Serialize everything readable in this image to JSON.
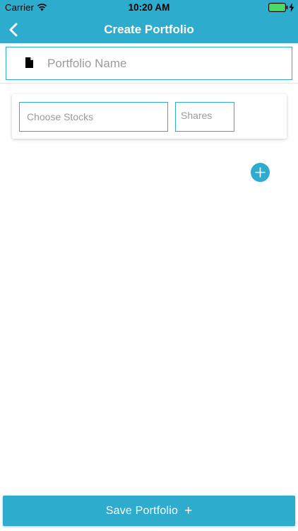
{
  "theme": {
    "accent": "#2eaccd",
    "text_on_accent": "#ffffff",
    "placeholder": "#9b9b9b"
  },
  "status_bar": {
    "carrier": "Carrier",
    "time": "10:20 AM",
    "icons": [
      "wifi-icon",
      "battery-icon",
      "charging-bolt-icon"
    ]
  },
  "nav": {
    "title": "Create Portfolio",
    "back_icon": "chevron-left-icon"
  },
  "form": {
    "portfolio_name": {
      "value": "",
      "placeholder": "Portfolio Name",
      "icon": "document-icon"
    },
    "stock_rows": [
      {
        "stock": {
          "value": "",
          "placeholder": "Choose Stocks"
        },
        "shares": {
          "value": "",
          "placeholder": "Shares"
        }
      }
    ],
    "add_row_icon": "plus-circle-icon"
  },
  "footer": {
    "save_label": "Save Portfolio",
    "save_symbol": "+"
  }
}
